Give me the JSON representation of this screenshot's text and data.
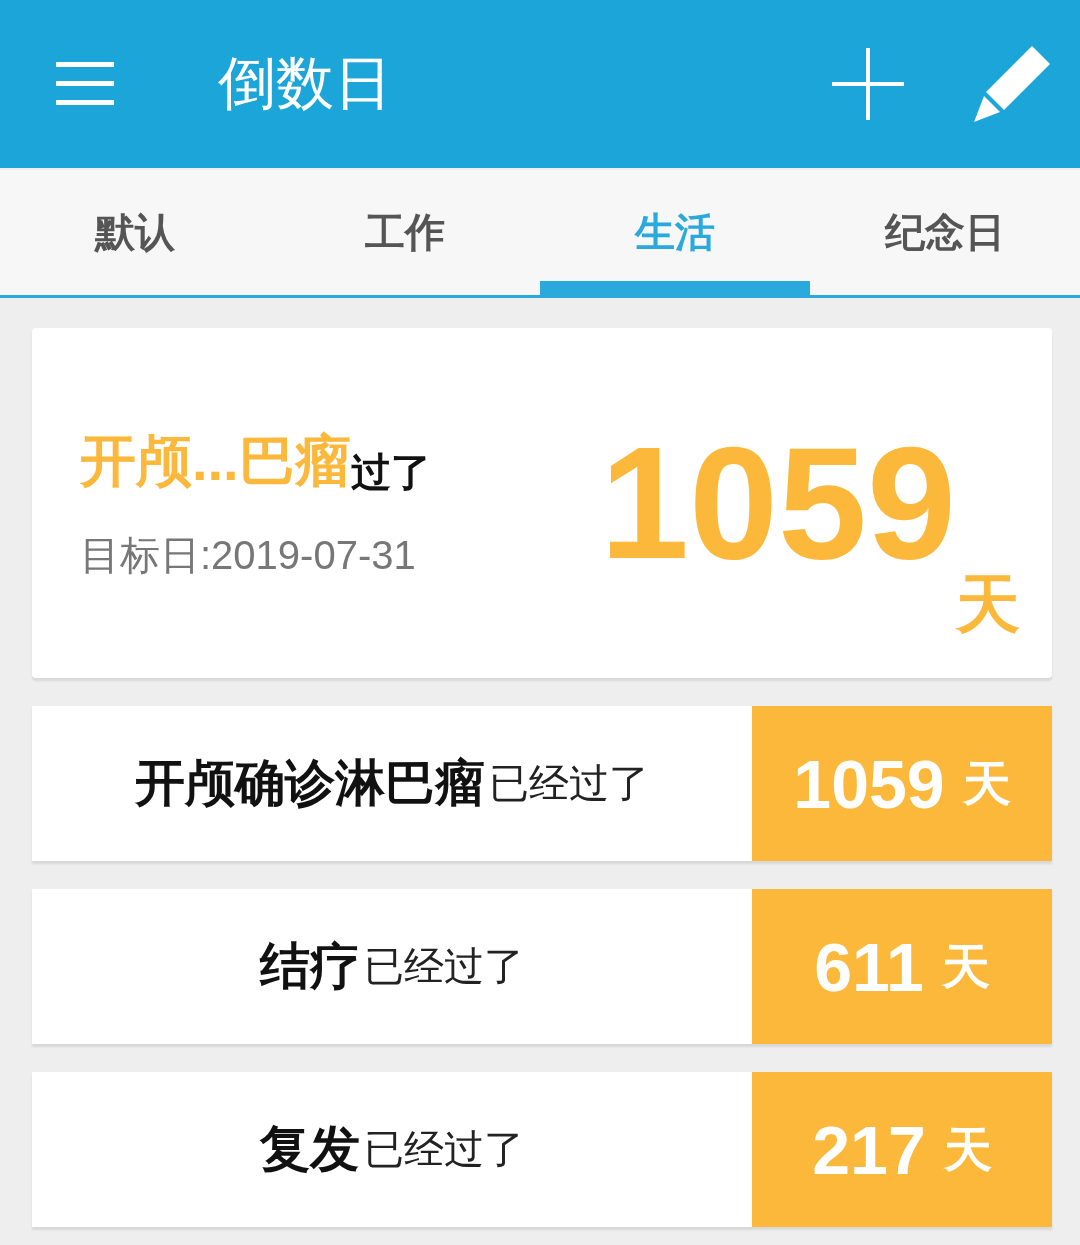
{
  "header": {
    "title": "倒数日"
  },
  "tabs": [
    {
      "label": "默认",
      "selected": false
    },
    {
      "label": "工作",
      "selected": false
    },
    {
      "label": "生活",
      "selected": true
    },
    {
      "label": "纪念日",
      "selected": false
    }
  ],
  "featured": {
    "name": "开颅...巴瘤",
    "suffix": "过了",
    "date": "目标日:2019-07-31",
    "count": "1059",
    "unit": "天"
  },
  "events": [
    {
      "name": "开颅确诊淋巴瘤",
      "suffix": "已经过了",
      "count": "1059",
      "unit": "天"
    },
    {
      "name": "结疗",
      "suffix": "已经过了",
      "count": "611",
      "unit": "天"
    },
    {
      "name": "复发",
      "suffix": "已经过了",
      "count": "217",
      "unit": "天"
    }
  ]
}
